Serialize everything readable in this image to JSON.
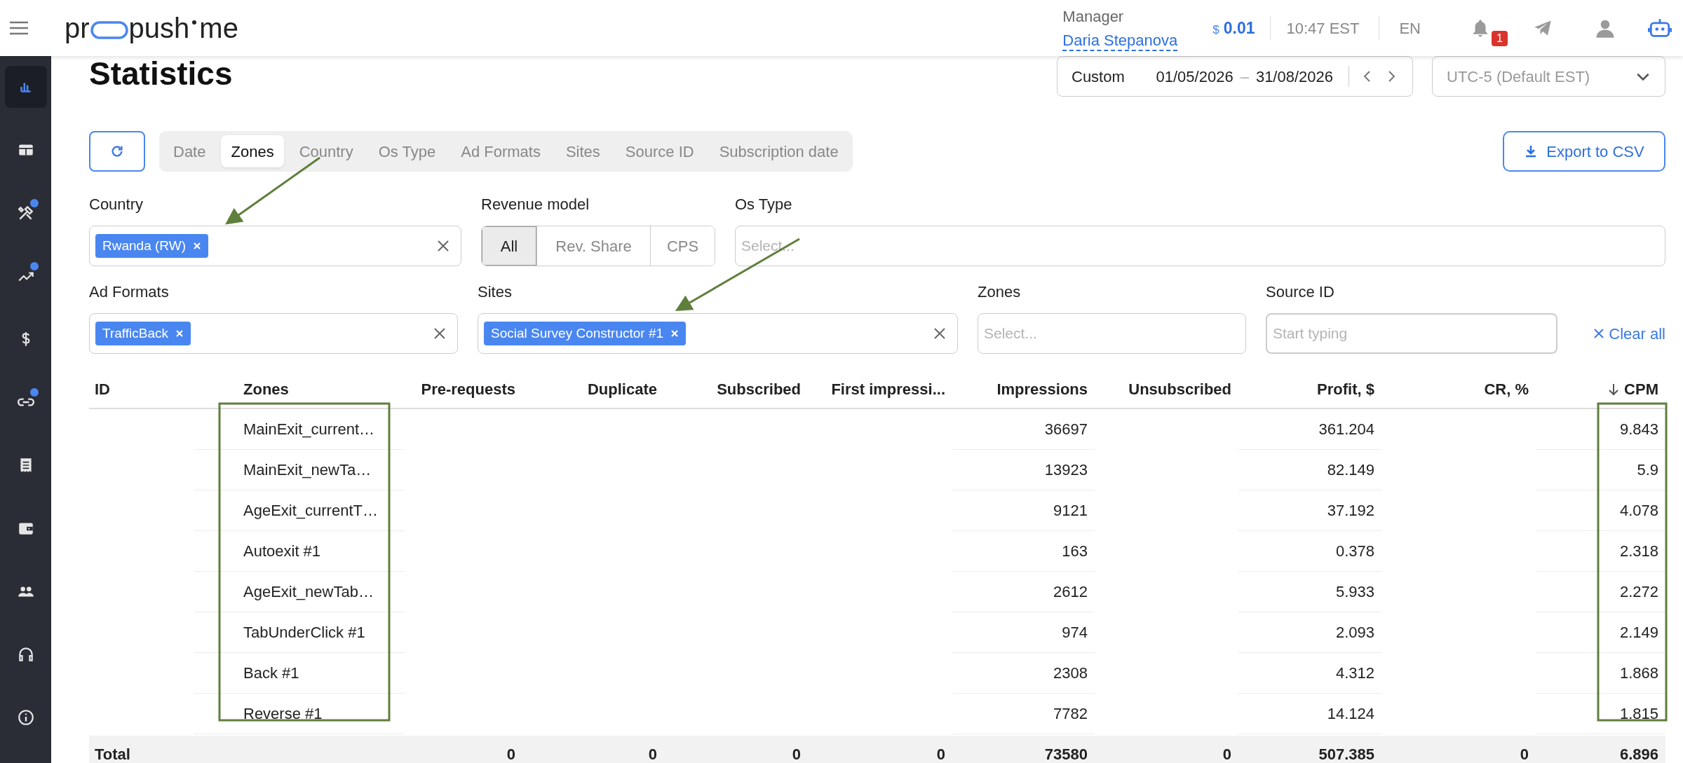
{
  "top_bar": {
    "logo": [
      "pr",
      "push",
      "me"
    ],
    "role": "Manager",
    "user": "Daria Stepanova",
    "currency": "$",
    "balance": "0.01",
    "time": "10:47 EST",
    "language": "EN",
    "notifications": "1"
  },
  "sidebar": {
    "items": [
      {
        "selected": true,
        "dot": false
      },
      {
        "selected": false,
        "dot": false
      },
      {
        "selected": false,
        "dot": true
      },
      {
        "selected": false,
        "dot": true
      },
      {
        "selected": false,
        "dot": false
      },
      {
        "selected": false,
        "dot": true
      },
      {
        "selected": false,
        "dot": false
      },
      {
        "selected": false,
        "dot": false
      },
      {
        "selected": false,
        "dot": false
      },
      {
        "selected": false,
        "dot": false
      },
      {
        "selected": false,
        "dot": false
      }
    ]
  },
  "page": {
    "title": "Statistics",
    "date_range": {
      "preset": "Custom",
      "from": "01/05/2026",
      "separator": "–",
      "to": "31/08/2026"
    },
    "timezone": "UTC-5 (Default EST)"
  },
  "group_by_tabs": [
    {
      "label": "Date",
      "selected": false
    },
    {
      "label": "Zones",
      "selected": true
    },
    {
      "label": "Country",
      "selected": false
    },
    {
      "label": "Os Type",
      "selected": false
    },
    {
      "label": "Ad Formats",
      "selected": false
    },
    {
      "label": "Sites",
      "selected": false
    },
    {
      "label": "Source ID",
      "selected": false
    },
    {
      "label": "Subscription date",
      "selected": false
    }
  ],
  "export_button": "Export to CSV",
  "filter_rows": [
    [
      {
        "kind": "tags",
        "label": "Country",
        "tags": [
          "Rwanda (RW)"
        ]
      },
      {
        "kind": "segmented",
        "label": "Revenue model",
        "options": [
          {
            "label": "All",
            "selected": true
          },
          {
            "label": "Rev. Share",
            "selected": false
          },
          {
            "label": "CPS",
            "selected": false
          }
        ]
      },
      {
        "kind": "select",
        "label": "Os Type",
        "placeholder": "Select..."
      }
    ],
    [
      {
        "kind": "tags",
        "label": "Ad Formats",
        "tags": [
          "TrafficBack"
        ]
      },
      {
        "kind": "tags",
        "label": "Sites",
        "tags": [
          "Social Survey Constructor #1"
        ]
      },
      {
        "kind": "select",
        "label": "Zones",
        "placeholder": "Select..."
      },
      {
        "kind": "input",
        "label": "Source ID",
        "placeholder": "Start typing"
      }
    ]
  ],
  "clear_all": "Clear all",
  "table": {
    "columns": [
      {
        "label": "ID",
        "sorted": false
      },
      {
        "label": "Zones",
        "sorted": false
      },
      {
        "label": "Pre-requests",
        "sorted": false
      },
      {
        "label": "Duplicate",
        "sorted": false
      },
      {
        "label": "Subscribed",
        "sorted": false
      },
      {
        "label": "First impressi...",
        "sorted": false
      },
      {
        "label": "Impressions",
        "sorted": false
      },
      {
        "label": "Unsubscribed",
        "sorted": false
      },
      {
        "label": "Profit, $",
        "sorted": false
      },
      {
        "label": "CR, %",
        "sorted": false
      },
      {
        "label": "CPM",
        "sorted": true
      }
    ],
    "rows": [
      {
        "cells": [
          null,
          "MainExit_current…",
          null,
          null,
          null,
          null,
          "36697",
          null,
          "361.204",
          null,
          "9.843"
        ]
      },
      {
        "cells": [
          null,
          "MainExit_newTa…",
          null,
          null,
          null,
          null,
          "13923",
          null,
          "82.149",
          null,
          "5.9"
        ]
      },
      {
        "cells": [
          null,
          "AgeExit_currentT…",
          null,
          null,
          null,
          null,
          "9121",
          null,
          "37.192",
          null,
          "4.078"
        ]
      },
      {
        "cells": [
          null,
          "Autoexit #1",
          null,
          null,
          null,
          null,
          "163",
          null,
          "0.378",
          null,
          "2.318"
        ]
      },
      {
        "cells": [
          null,
          "AgeExit_newTab…",
          null,
          null,
          null,
          null,
          "2612",
          null,
          "5.933",
          null,
          "2.272"
        ]
      },
      {
        "cells": [
          null,
          "TabUnderClick #1",
          null,
          null,
          null,
          null,
          "974",
          null,
          "2.093",
          null,
          "2.149"
        ]
      },
      {
        "cells": [
          null,
          "Back #1",
          null,
          null,
          null,
          null,
          "2308",
          null,
          "4.312",
          null,
          "1.868"
        ]
      },
      {
        "cells": [
          null,
          "Reverse #1",
          null,
          null,
          null,
          null,
          "7782",
          null,
          "14.124",
          null,
          "1.815"
        ]
      }
    ],
    "total": {
      "cells": [
        "Total",
        null,
        "0",
        "0",
        "0",
        "0",
        "73580",
        "0",
        "507.385",
        "0",
        "6.896"
      ]
    }
  }
}
